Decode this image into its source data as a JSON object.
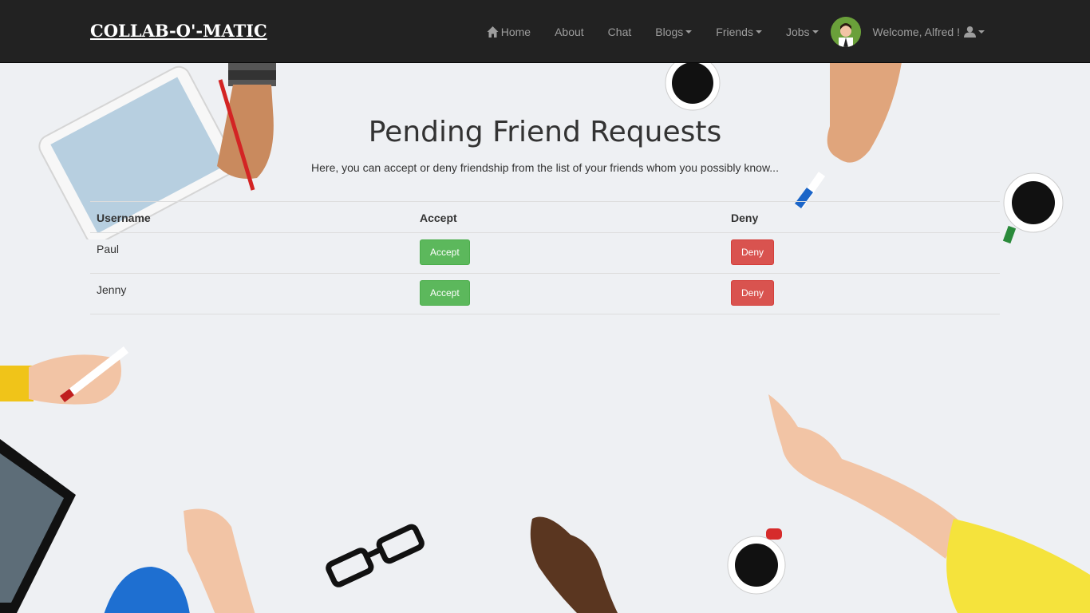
{
  "brand": "COLLAB-O'-MATIC",
  "nav": {
    "home": "Home",
    "about": "About",
    "chat": "Chat",
    "blogs": "Blogs",
    "friends": "Friends",
    "jobs": "Jobs",
    "welcome": "Welcome, Alfred !"
  },
  "page": {
    "title": "Pending Friend Requests",
    "subtitle": "Here, you can accept or deny friendship from the list of your friends whom you possibly know..."
  },
  "table": {
    "headers": [
      "Username",
      "Accept",
      "Deny"
    ],
    "rows": [
      {
        "username": "Paul",
        "accept": "Accept",
        "deny": "Deny"
      },
      {
        "username": "Jenny",
        "accept": "Accept",
        "deny": "Deny"
      }
    ]
  },
  "colors": {
    "navbar": "#222222",
    "accept": "#5cb85c",
    "deny": "#d9534f"
  }
}
